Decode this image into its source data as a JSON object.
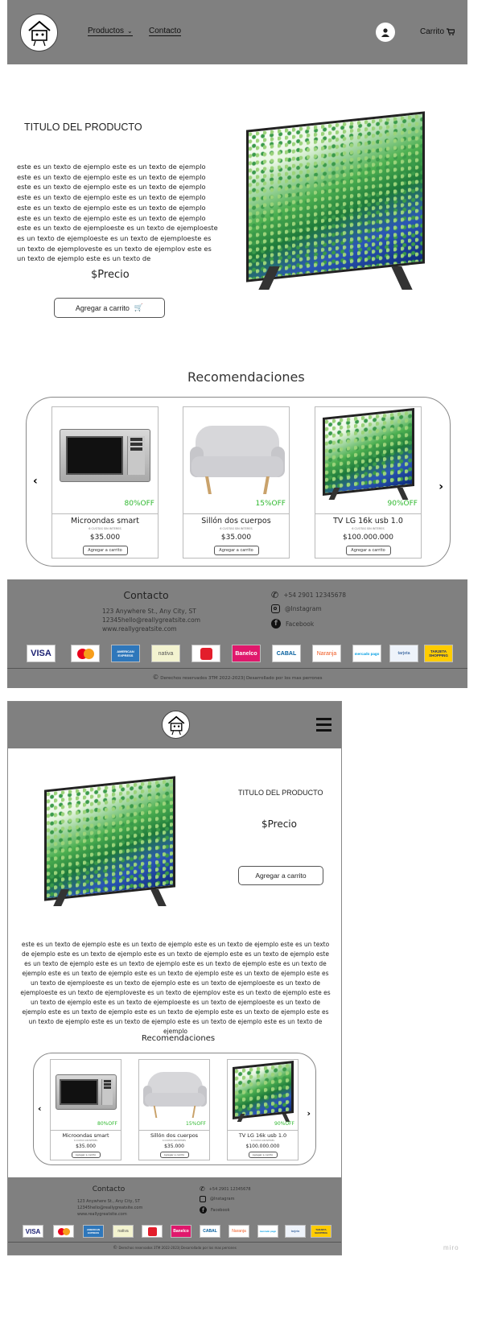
{
  "desktop": {
    "nav": {
      "productos": "Productos",
      "contacto": "Contacto",
      "carrito": "Carrito"
    },
    "product": {
      "title": "TITULO DEL PRODUCTO",
      "description": "este es un texto  de ejemplo este es un texto de ejemplo este es un texto de ejemplo este es un texto de ejemplo este es un texto de ejemplo este es un texto de ejemplo este es un texto de ejemplo este es un texto de ejemplo este es un texto de ejemplo este es un texto de ejemplo este es un texto de ejemplo este es un texto de ejemplo este es un texto de ejemploeste es un texto de ejemploeste es un texto de ejemploeste es un texto de ejemploeste es un texto de ejemploveste es un texto de ejemplov este es un texto de ejemplo este es un texto de",
      "price": "$Precio",
      "add_to_cart": "Agregar a carrito"
    },
    "recommendations": {
      "title": "Recomendaciones",
      "items": [
        {
          "name": "Microondas smart",
          "discount": "80%OFF",
          "cuotas": "6 CUOTAS SIN INTERES",
          "price": "$35.000",
          "button": "Agregar a carrito"
        },
        {
          "name": "Sillón dos cuerpos",
          "discount": "15%OFF",
          "cuotas": "6 CUOTAS SIN INTERES",
          "price": "$35.000",
          "button": "Agregar a carrito"
        },
        {
          "name": "TV LG 16k usb 1.0",
          "discount": "90%OFF",
          "cuotas": "6 CUOTAS SIN INTERES",
          "price": "$100.000.000",
          "button": "Agregar a carrito"
        }
      ]
    },
    "footer": {
      "contact_title": "Contacto",
      "address": "123 Anywhere St., Any City, ST",
      "email": "12345hello@reallygreatsite.com",
      "website": "www.reallygreatsite.com",
      "phone": "+54 2901 12345678",
      "instagram": "@Instagram",
      "facebook": "Facebook",
      "copyright": "Derechos reservados 3TM 2022-2023| Desarrollado por los mas perrones"
    }
  },
  "mobile": {
    "product": {
      "title": "TITULO DEL PRODUCTO",
      "price": "$Precio",
      "add_to_cart": "Agregar a carrito",
      "description": "este es un texto  de ejemplo este es un texto de ejemplo este es un texto de ejemplo este es un texto de ejemplo este es un texto de ejemplo este es un texto de ejemplo este es un texto de ejemplo este es un texto de ejemplo este es un texto de ejemplo este es un texto de ejemplo este es un texto de ejemplo este es un texto de ejemplo este es un texto de ejemplo este es un texto de ejemplo este es un texto de ejemploeste es un texto de ejemplo este es un texto de ejemploeste es un texto de ejemploeste es un texto de ejemploveste es un texto de ejemplov este es un texto de ejemplo este es un texto de ejemplo este es un texto de ejemploeste es un texto de ejemploeste es un texto de ejemplo este es un texto de ejemplo este es un texto de ejemplo este es un texto de ejemplo este es un texto de ejemplo este es un texto de ejemplo este es un texto de ejemplo este es un texto de ejemplo"
    },
    "recommendations": {
      "title": "Recomendaciones",
      "items": [
        {
          "name": "Microondas smart",
          "discount": "80%OFF",
          "cuotas": "6 CUOTAS SIN INTERES",
          "price": "$35.000",
          "button": "Agregar a carrito"
        },
        {
          "name": "Sillón dos cuerpos",
          "discount": "15%OFF",
          "cuotas": "6 CUOTAS SIN INTERES",
          "price": "$35.000",
          "button": "Agregar a carrito"
        },
        {
          "name": "TV LG 16k usb 1.0",
          "discount": "90%OFF",
          "cuotas": "6 CUOTAS SIN INTERES",
          "price": "$100.000.000",
          "button": "Agregar a carrito"
        }
      ]
    },
    "footer": {
      "contact_title": "Contacto",
      "address": "123 Anywhere St., Any City, ST",
      "email": "12345hello@reallygreatsite.com",
      "website": "www.reallygreatsite.com",
      "phone": "+54 2901 12345678",
      "instagram": "@Instagram",
      "facebook": "Facebook",
      "copyright": "Derechos reservados 3TM 2022-2023| Desarrollado por los mas perrones"
    }
  },
  "payment_methods": [
    "VISA",
    "mastercard",
    "AMERICAN EXPRESS",
    "nativa",
    "Cabal red",
    "Banelco",
    "CABAL",
    "Naranja",
    "mercado pago",
    "tarjeta",
    "TARJETA SHOPPING"
  ],
  "watermark": "miro"
}
